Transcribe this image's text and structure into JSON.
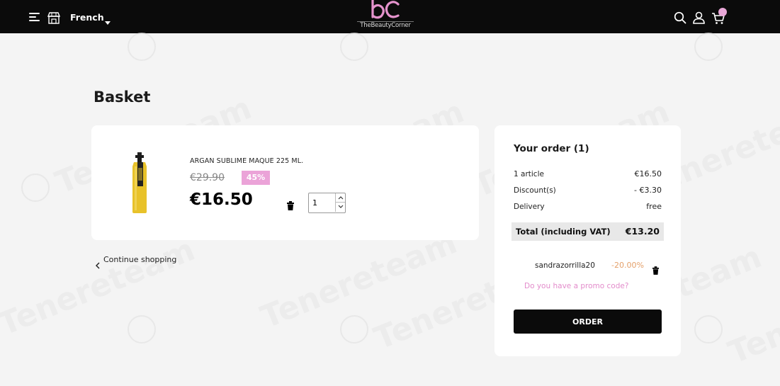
{
  "header": {
    "language": "French",
    "logo_text": "TheBeautyCorner",
    "icons": [
      "menu-icon",
      "store-icon",
      "search-icon",
      "user-icon",
      "cart-icon"
    ],
    "colors": {
      "bar": "#0b0b0b",
      "accent": "#e38ccb"
    }
  },
  "watermark": {
    "text": "Tenereteam"
  },
  "page": {
    "title": "Basket"
  },
  "product": {
    "name": "ARGAN SUBLIME MAQUE 225 ML.",
    "old_price": "€29.90",
    "discount": "45%",
    "price": "€16.50",
    "quantity": "1"
  },
  "links": {
    "continue_shopping": "Continue shopping"
  },
  "order": {
    "title": "Your order (1)",
    "rows": [
      {
        "label": "1 article",
        "value": "€16.50"
      },
      {
        "label": "Discount(s)",
        "value": "- €3.30"
      },
      {
        "label": "Delivery",
        "value": "free"
      }
    ],
    "total_label": "Total (including VAT)",
    "total_value": "€13.20",
    "promo": {
      "code": "sandrazorrilla20",
      "percent": "-20.00%"
    },
    "promo_link": "Do you have a promo code?",
    "button": "ORDER"
  }
}
